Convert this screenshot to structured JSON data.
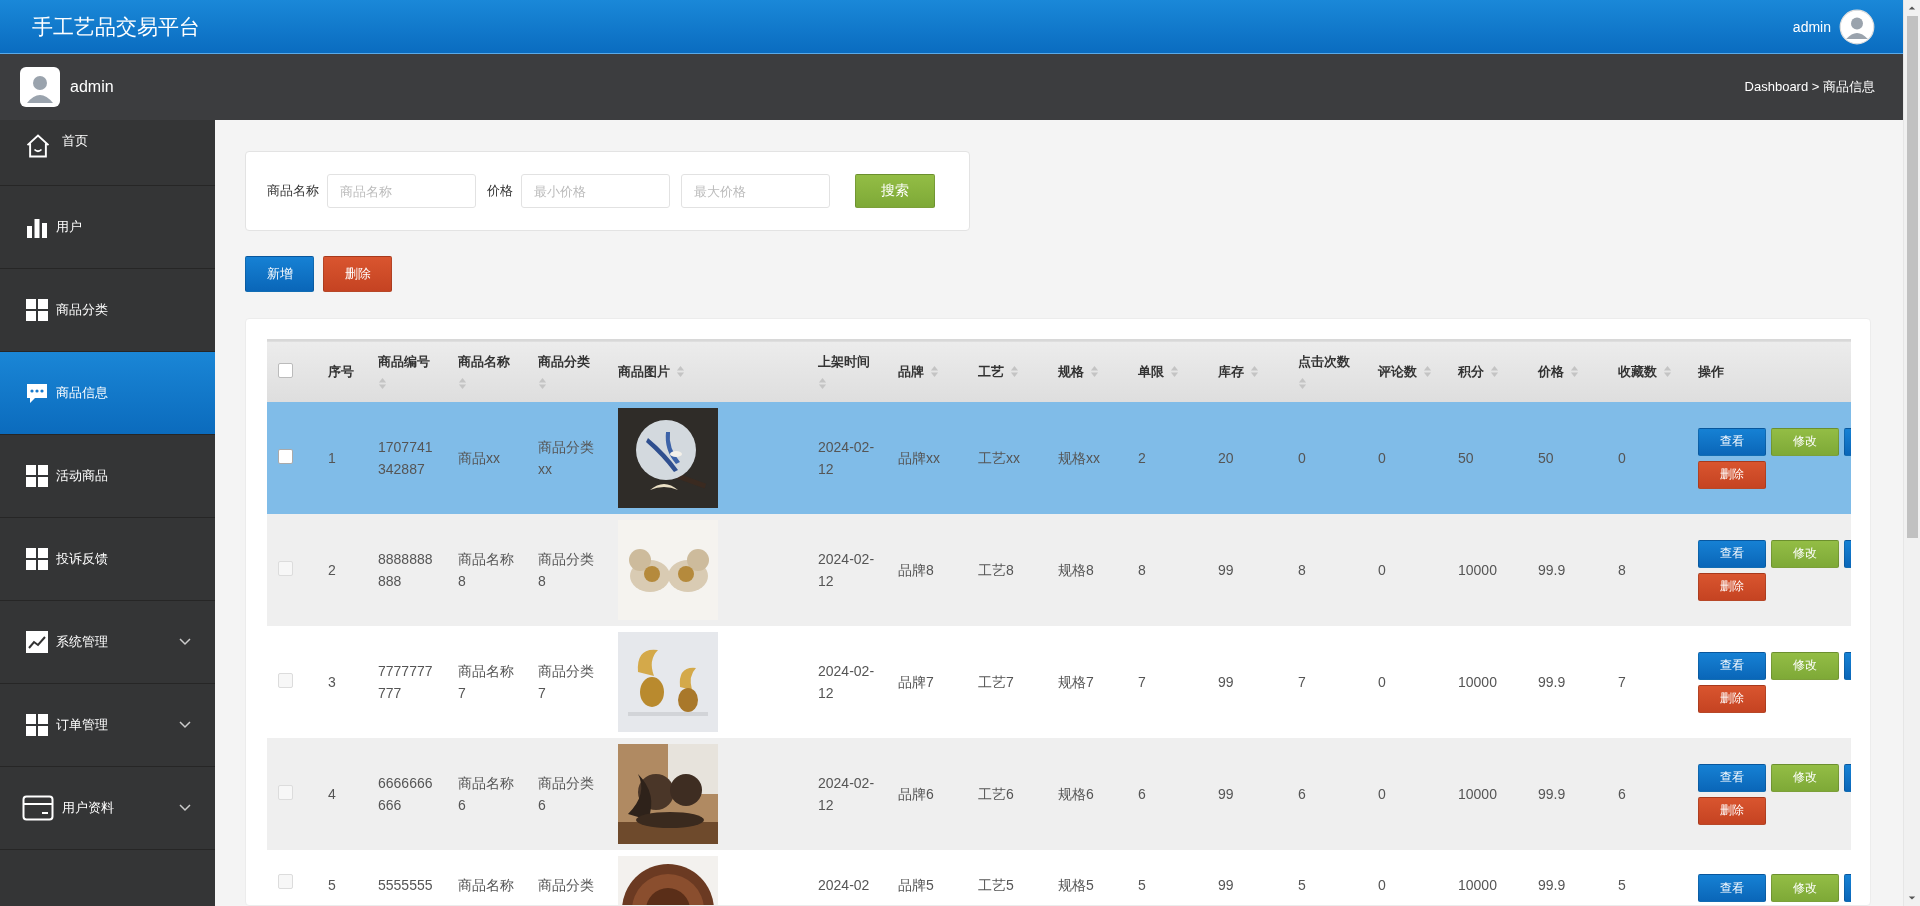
{
  "header": {
    "title": "手工艺品交易平台",
    "user": "admin"
  },
  "subbar": {
    "user": "admin",
    "breadcrumb": "Dashboard > 商品信息"
  },
  "sidebar": {
    "items": [
      {
        "label": "首页",
        "selected": false
      },
      {
        "label": "用户",
        "selected": false
      },
      {
        "label": "商品分类",
        "selected": false
      },
      {
        "label": "商品信息",
        "selected": true
      },
      {
        "label": "活动商品",
        "selected": false
      },
      {
        "label": "投诉反馈",
        "selected": false
      },
      {
        "label": "系统管理",
        "selected": false,
        "expanded": false
      },
      {
        "label": "订单管理",
        "selected": false,
        "expanded": false
      },
      {
        "label": "用户资料",
        "selected": false,
        "expanded": false
      }
    ]
  },
  "search": {
    "fields": [
      {
        "label": "商品名称",
        "placeholder": "商品名称"
      },
      {
        "label": "价格",
        "placeholder": "最小价格"
      },
      {
        "placeholder": "最大价格"
      }
    ],
    "button": "搜索"
  },
  "toolbar": [
    {
      "label": "新增",
      "kind": "add"
    },
    {
      "label": "删除",
      "kind": "delete"
    }
  ],
  "table": {
    "header_checked": false,
    "columns": [
      {
        "label": "序号",
        "kind": "text",
        "sortable": false
      },
      {
        "label": "商品编号",
        "kind": "text",
        "sortable": true
      },
      {
        "label": "商品名称",
        "kind": "text",
        "sortable": true
      },
      {
        "label": "商品分类",
        "kind": "text",
        "sortable": true
      },
      {
        "label": "商品图片",
        "sortable": true
      },
      {
        "label": "上架时间",
        "kind": "text",
        "sortable": true
      },
      {
        "label": "品牌",
        "kind": "text",
        "sortable": true
      },
      {
        "label": "工艺",
        "kind": "text",
        "sortable": true
      },
      {
        "label": "规格",
        "kind": "text",
        "sortable": true
      },
      {
        "label": "单限",
        "kind": "text",
        "sortable": true
      },
      {
        "label": "库存",
        "kind": "text",
        "sortable": true
      },
      {
        "label": "点击次数",
        "kind": "text",
        "sortable": true
      },
      {
        "label": "评论数",
        "kind": "text",
        "sortable": true
      },
      {
        "label": "积分",
        "kind": "text",
        "sortable": true
      },
      {
        "label": "价格",
        "kind": "text",
        "sortable": true
      },
      {
        "label": "收藏数",
        "kind": "text",
        "sortable": true
      },
      {
        "label": "操作",
        "kind": "actions",
        "sortable": false
      }
    ],
    "rows": [
      {
        "selected": true,
        "checked": false,
        "cells": [
          "1",
          "1707741342887",
          "商品xx",
          "商品分类xx",
          "",
          "2024-02-12",
          "品牌xx",
          "工艺xx",
          "规格xx",
          "2",
          "20",
          "0",
          "0",
          "50",
          "50",
          "0"
        ],
        "actions": [
          {
            "kind": "view",
            "label": "查看"
          },
          {
            "kind": "edit",
            "label": "修改"
          },
          {
            "kind": "cut"
          },
          {
            "kind": "delete",
            "label": "删除"
          }
        ]
      },
      {
        "selected": false,
        "checked": false,
        "cells": [
          "2",
          "8888888888",
          "商品名称8",
          "商品分类8",
          "",
          "2024-02-12",
          "品牌8",
          "工艺8",
          "规格8",
          "8",
          "99",
          "8",
          "0",
          "10000",
          "99.9",
          "8"
        ],
        "actions": [
          {
            "kind": "view",
            "label": "查看"
          },
          {
            "kind": "edit",
            "label": "修改"
          },
          {
            "kind": "cut"
          },
          {
            "kind": "delete",
            "label": "删除"
          }
        ]
      },
      {
        "selected": false,
        "checked": false,
        "cells": [
          "3",
          "7777777777",
          "商品名称7",
          "商品分类7",
          "",
          "2024-02-12",
          "品牌7",
          "工艺7",
          "规格7",
          "7",
          "99",
          "7",
          "0",
          "10000",
          "99.9",
          "7"
        ],
        "actions": [
          {
            "kind": "view",
            "label": "查看"
          },
          {
            "kind": "edit",
            "label": "修改"
          },
          {
            "kind": "cut"
          },
          {
            "kind": "delete",
            "label": "删除"
          }
        ]
      },
      {
        "selected": false,
        "checked": false,
        "cells": [
          "4",
          "6666666666",
          "商品名称6",
          "商品分类6",
          "",
          "2024-02-12",
          "品牌6",
          "工艺6",
          "规格6",
          "6",
          "99",
          "6",
          "0",
          "10000",
          "99.9",
          "6"
        ],
        "actions": [
          {
            "kind": "view",
            "label": "查看"
          },
          {
            "kind": "edit",
            "label": "修改"
          },
          {
            "kind": "cut"
          },
          {
            "kind": "delete",
            "label": "删除"
          }
        ]
      },
      {
        "selected": false,
        "checked": false,
        "cells": [
          "5",
          "5555555",
          "商品名称",
          "商品分类",
          "",
          "2024-02",
          "品牌5",
          "工艺5",
          "规格5",
          "5",
          "99",
          "5",
          "0",
          "10000",
          "99.9",
          "5"
        ],
        "actions": [
          {
            "kind": "view",
            "label": "查看"
          },
          {
            "kind": "edit",
            "label": "修改"
          },
          {
            "kind": "cut"
          }
        ]
      }
    ]
  }
}
